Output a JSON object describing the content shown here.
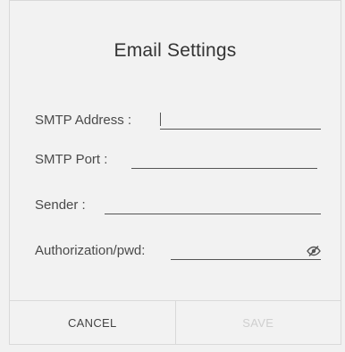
{
  "dialog": {
    "title": "Email Settings",
    "fields": [
      {
        "label": "SMTP Address :",
        "value": "",
        "placeholder": ""
      },
      {
        "label": "SMTP Port :",
        "value": "",
        "placeholder": ""
      },
      {
        "label": "Sender :",
        "value": "",
        "placeholder": ""
      },
      {
        "label": "Authorization/pwd:",
        "value": "",
        "placeholder": "",
        "icon": "eye-off-icon"
      }
    ],
    "buttons": {
      "cancel_label": "CANCEL",
      "save_label": "SAVE"
    }
  },
  "colors": {
    "text": "#4a4a4a",
    "underline": "#555555",
    "disabled": "#cfcfcf",
    "background": "#f2f2f2"
  }
}
